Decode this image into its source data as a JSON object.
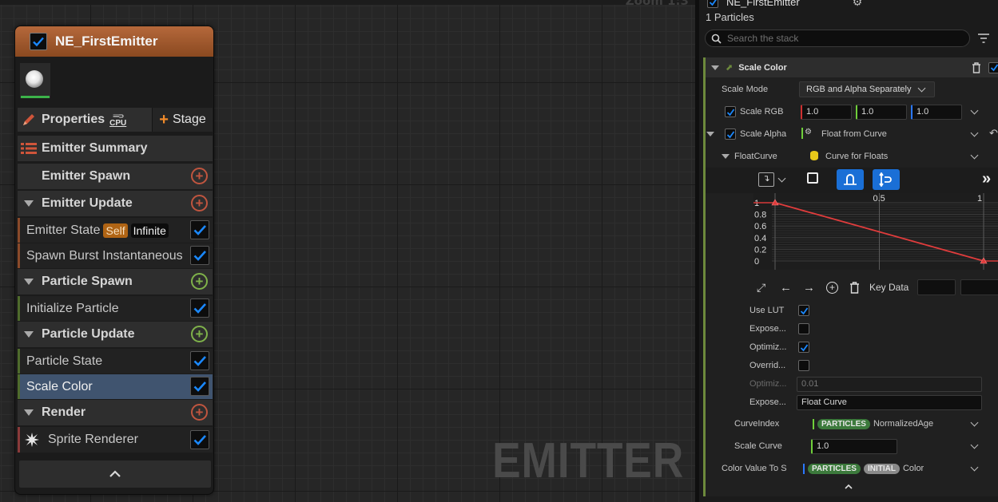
{
  "graph": {
    "zoom_text": "Zoom 1:3",
    "watermark": "EMITTER"
  },
  "emitter_node": {
    "title": "NE_FirstEmitter",
    "properties_label": "Properties",
    "sim_target": "CPU",
    "stage_label": "Stage",
    "sections": {
      "emitter_summary": "Emitter Summary",
      "emitter_spawn": "Emitter Spawn",
      "emitter_update": "Emitter Update",
      "particle_spawn": "Particle Spawn",
      "particle_update": "Particle Update",
      "render": "Render"
    },
    "modules": {
      "emitter_state": "Emitter State",
      "emitter_state_badge_self": "Self",
      "emitter_state_badge_infinite": "Infinite",
      "spawn_burst": "Spawn Burst Instantaneous",
      "initialize_particle": "Initialize Particle",
      "particle_state": "Particle State",
      "scale_color": "Scale Color",
      "sprite_renderer": "Sprite Renderer"
    },
    "colors": {
      "emitter": "#c16f3f",
      "spawn_green": "#7fb24a",
      "add_red": "#c0553f",
      "selected": "#40546f",
      "check_blue": "#1a88ff"
    }
  },
  "details": {
    "title": "NE_FirstEmitter",
    "particles_count": "1 Particles",
    "search_placeholder": "Search the stack",
    "module_title": "Scale Color",
    "scale_mode_label": "Scale Mode",
    "scale_mode_value": "RGB and Alpha Separately",
    "scale_rgb_label": "Scale RGB",
    "scale_rgb_values": [
      "1.0",
      "1.0",
      "1.0"
    ],
    "scale_alpha_label": "Scale Alpha",
    "scale_alpha_value": "Float from Curve",
    "float_curve_label": "FloatCurve",
    "float_curve_value": "Curve for Floats",
    "curve_x_ticks": [
      "0.5",
      "1"
    ],
    "curve_y_ticks": [
      "1",
      "0.8",
      "0.6",
      "0.4",
      "0.2",
      "0"
    ],
    "curve_keys": [
      {
        "x": 0,
        "y": 1
      },
      {
        "x": 1,
        "y": 0
      }
    ],
    "key_data_label": "Key Data",
    "use_lut_label": "Use LUT",
    "expose_label": "Expose...",
    "optimize_label": "Optimiz...",
    "override_label": "Overrid...",
    "optimize_value_label": "Optimiz...",
    "optimize_value": "0.01",
    "expose_value_label": "Expose...",
    "expose_value": "Float Curve",
    "curve_index_label": "CurveIndex",
    "curve_index_pill": "PARTICLES",
    "curve_index_value": "NormalizedAge",
    "scale_curve_label": "Scale Curve",
    "scale_curve_value": "1.0",
    "color_value_label": "Color Value To S",
    "color_value_pill1": "PARTICLES",
    "color_value_pill2": "INITIAL",
    "color_value_value": "Color"
  }
}
